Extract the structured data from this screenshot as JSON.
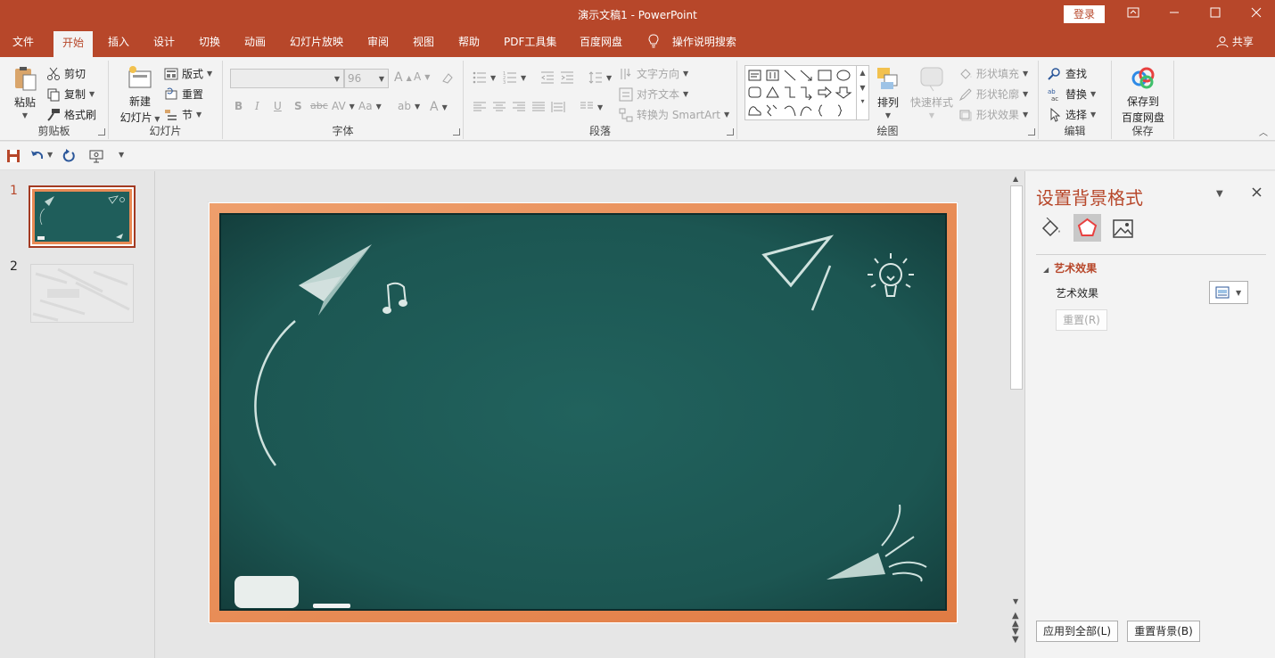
{
  "window": {
    "title": "演示文稿1 - PowerPoint",
    "login_label": "登录",
    "controls": [
      "ribbon-display",
      "minimize",
      "maximize",
      "close"
    ]
  },
  "tabs": [
    {
      "label": "文件"
    },
    {
      "label": "开始",
      "active": true
    },
    {
      "label": "插入"
    },
    {
      "label": "设计"
    },
    {
      "label": "切换"
    },
    {
      "label": "动画"
    },
    {
      "label": "幻灯片放映"
    },
    {
      "label": "审阅"
    },
    {
      "label": "视图"
    },
    {
      "label": "帮助"
    },
    {
      "label": "PDF工具集"
    },
    {
      "label": "百度网盘"
    }
  ],
  "tell_me": "操作说明搜索",
  "share": "共享",
  "ribbon": {
    "clipboard": {
      "label": "剪贴板",
      "paste": "粘贴",
      "cut": "剪切",
      "copy": "复制",
      "format_painter": "格式刷"
    },
    "slides": {
      "label": "幻灯片",
      "new_slide_line1": "新建",
      "new_slide_line2": "幻灯片",
      "layout": "版式",
      "reset": "重置",
      "section": "节"
    },
    "font": {
      "label": "字体",
      "font_name": "",
      "font_size": "96"
    },
    "paragraph": {
      "label": "段落",
      "text_direction": "文字方向",
      "align_text": "对齐文本",
      "convert_smartart": "转换为 SmartArt"
    },
    "drawing": {
      "label": "绘图",
      "arrange": "排列",
      "quick_styles": "快速样式",
      "shape_fill": "形状填充",
      "shape_outline": "形状轮廓",
      "shape_effects": "形状效果"
    },
    "editing": {
      "label": "编辑",
      "find": "查找",
      "replace": "替换",
      "select": "选择"
    },
    "save": {
      "label": "保存",
      "save_to_line1": "保存到",
      "save_to_line2": "百度网盘"
    }
  },
  "thumbnails": [
    {
      "number": "1",
      "selected": true
    },
    {
      "number": "2",
      "selected": false
    }
  ],
  "format_pane": {
    "title": "设置背景格式",
    "section_title": "艺术效果",
    "row_label": "艺术效果",
    "reset_button": "重置(R)",
    "apply_all_button": "应用到全部(L)",
    "reset_background_button": "重置背景(B)"
  },
  "colors": {
    "accent": "#b7472a",
    "chalkboard": "#1f5e5b",
    "frame": "#e88a55"
  }
}
